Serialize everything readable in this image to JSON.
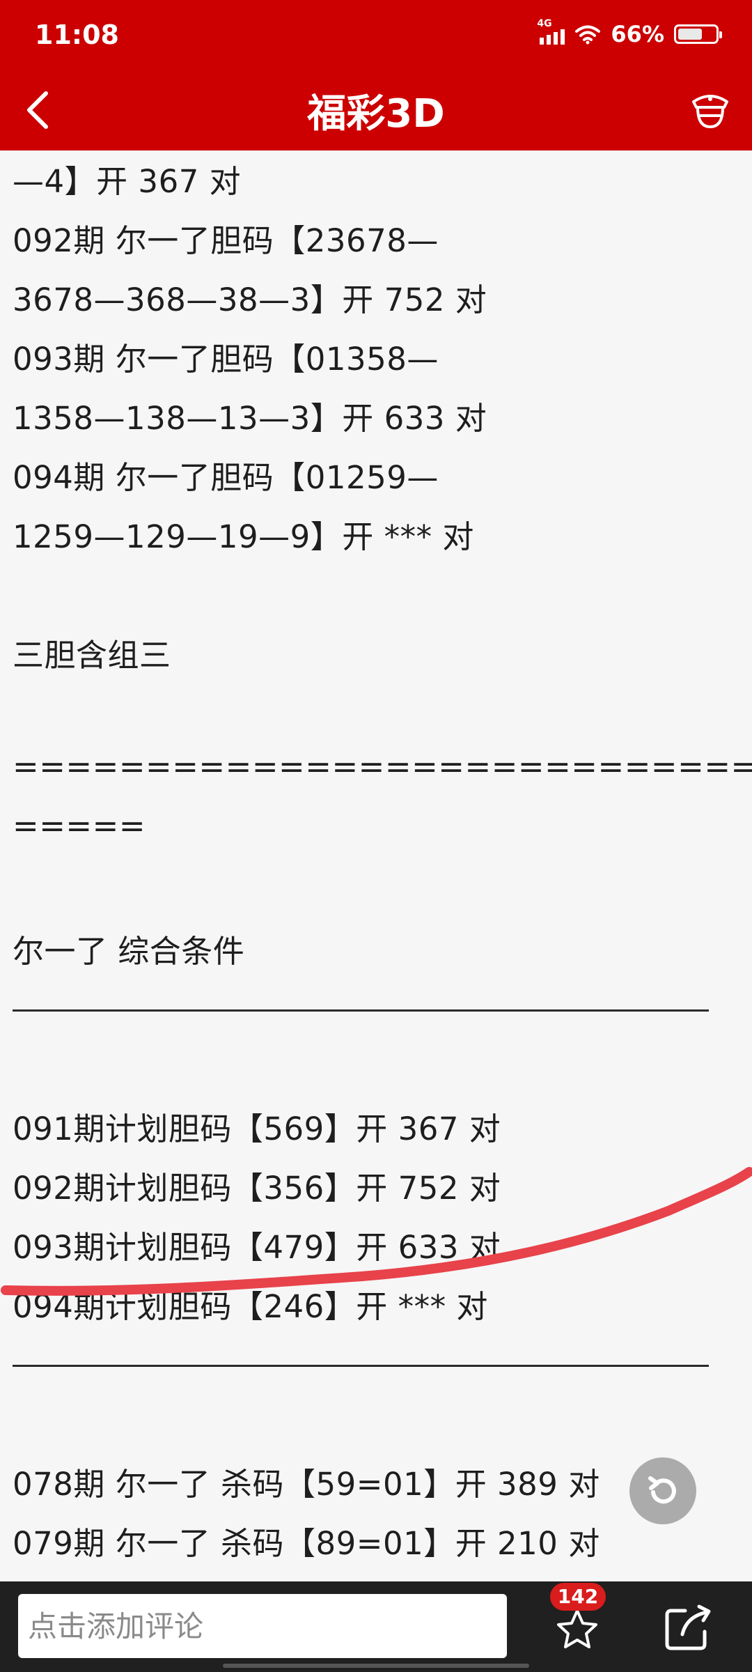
{
  "status_bar": {
    "time": "11:08",
    "network": "4G",
    "battery": "66%",
    "battery_fraction": 0.66
  },
  "header": {
    "title": "福彩3D"
  },
  "content": {
    "lines": [
      "—4】开 367 对",
      "092期 尔一了胆码【23678—",
      "3678—368—38—3】开 752 对",
      "093期 尔一了胆码【01358—",
      "1358—138—13—3】开 633 对",
      "094期 尔一了胆码【01259—",
      "1259—129—19—9】开 *** 对",
      "三胆含组三",
      "=====================================",
      "=====",
      "尔一了 综合条件",
      "091期计划胆码【569】开 367 对",
      "092期计划胆码【356】开 752 对",
      "093期计划胆码【479】开 633 对",
      "094期计划胆码【246】开 *** 对",
      "078期 尔一了 杀码【59=01】开 389 对",
      "079期 尔一了 杀码【89=01】开 210 对"
    ]
  },
  "bottom_bar": {
    "comment_placeholder": "点击添加评论",
    "favorite_count": "142"
  },
  "colors": {
    "brand_red": "#cc0000",
    "annotation_red": "#e8424a"
  }
}
